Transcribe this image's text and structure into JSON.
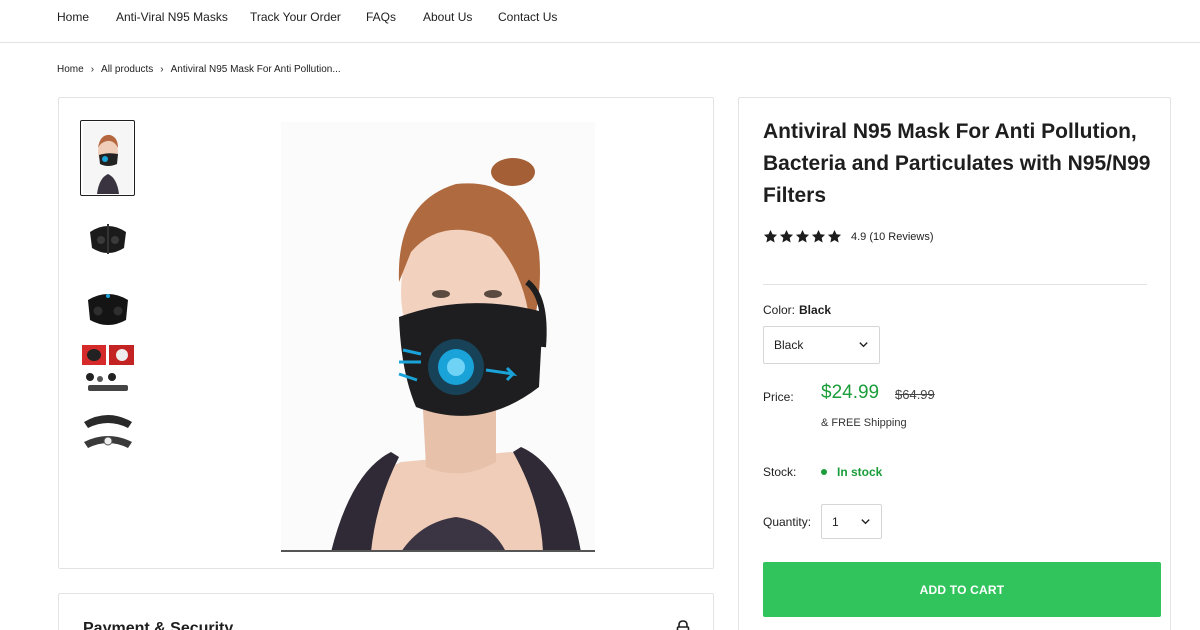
{
  "nav": {
    "items": [
      "Home",
      "Anti-Viral N95 Masks",
      "Track Your Order",
      "FAQs",
      "About Us",
      "Contact Us"
    ]
  },
  "breadcrumb": {
    "items": [
      "Home",
      "All products",
      "Antiviral N95 Mask For Anti Pollution..."
    ],
    "separator": "›"
  },
  "gallery": {
    "thumbnails": [
      "woman-wearing-mask",
      "mask-front-view",
      "mask-side-view",
      "mask-accessories-collage",
      "mask-parts-flat"
    ],
    "active_thumbnail": 0,
    "main_image": "woman-wearing-black-n95-mask"
  },
  "product": {
    "title": "Antiviral N95 Mask For Anti Pollution, Bacteria and Particulates with N95/N99 Filters",
    "rating_stars": 5,
    "rating_text": "4.9 (10 Reviews)",
    "color_label": "Color:",
    "color_value": "Black",
    "color_select": "Black",
    "price_label": "Price:",
    "price_now": "$24.99",
    "price_was": "$64.99",
    "shipping": "& FREE Shipping",
    "stock_label": "Stock:",
    "stock_value": "In stock",
    "quantity_label": "Quantity:",
    "quantity_value": "1",
    "add_to_cart": "ADD TO CART"
  },
  "payment": {
    "title": "Payment & Security"
  },
  "colors": {
    "accent_green": "#32c45c",
    "price_green": "#1c9d3b",
    "border": "#e3e3e3"
  }
}
